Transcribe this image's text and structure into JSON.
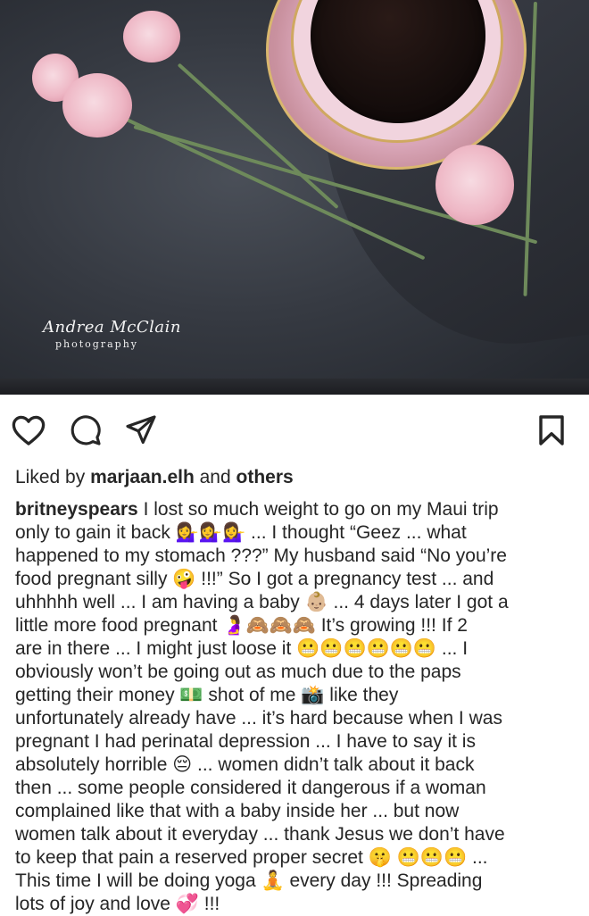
{
  "photo": {
    "watermark_name": "Andrea McClain",
    "watermark_sub": "photography"
  },
  "actions": {
    "like_icon": "heart-icon",
    "comment_icon": "comment-icon",
    "share_icon": "send-icon",
    "save_icon": "bookmark-icon"
  },
  "likes": {
    "prefix": "Liked by ",
    "user": "marjaan.elh",
    "middle": " and ",
    "others": "others"
  },
  "post": {
    "username": "britneyspears",
    "caption": " I lost so much weight to go on my Maui trip\nonly to gain it back 💁‍♀️💁‍♀️💁‍♀️ ... I thought “Geez ... what\nhappened to my stomach ???” My husband said “No you’re\nfood pregnant silly 🤪 !!!” So I got a pregnancy test ... and\nuhhhhh well ... I am having a baby 👶🏼 ... 4 days later I got a\nlittle more food pregnant 🤰🙈🙈🙈 It’s growing !!! If 2\nare in there ... I might just loose it 😬😬😬😬😬😬 ... I\nobviously won’t be going out as much due to the paps\ngetting their money 💵 shot of me 📸 like they\nunfortunately already have ... it’s hard because when I was\npregnant I had perinatal depression ... I have to say it is\nabsolutely horrible 😔 ... women didn’t talk about it back\nthen ... some people considered it dangerous if a woman\ncomplained like that with a baby inside her ... but now\nwomen talk about it everyday ... thank Jesus we don’t have\nto keep that pain a reserved proper secret 🤫 😬😬😬 ...\nThis time I will be doing yoga 🧘 every day !!! Spreading\nlots of joy and love 💞 !!!"
  }
}
